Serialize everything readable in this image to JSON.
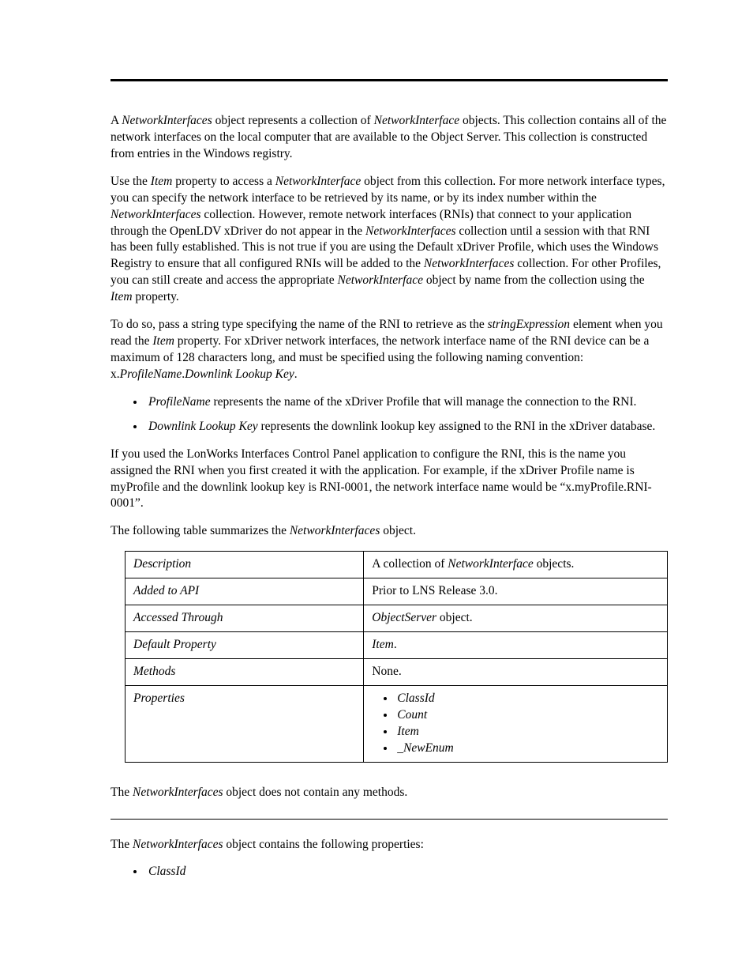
{
  "intro": {
    "p1_a": "A ",
    "p1_em1": "NetworkInterfaces",
    "p1_b": " object represents a collection of ",
    "p1_em2": "NetworkInterface",
    "p1_c": " objects.  This collection contains all of the network interfaces on the local computer that are available to the Object Server.  This collection is constructed from entries in the Windows registry.",
    "p2_a": "Use the ",
    "p2_em1": "Item",
    "p2_b": " property to access a ",
    "p2_em2": "NetworkInterface",
    "p2_c": " object from this collection. For more network interface types, you can specify the network interface to be retrieved by its name, or by its index number within the ",
    "p2_em3": "NetworkInterfaces",
    "p2_d": " collection. However, remote network interfaces (RNIs) that connect to your application through the OpenLDV xDriver do not appear in the ",
    "p2_em4": "NetworkInterfaces",
    "p2_e": " collection until a session with that RNI has been fully established. This is not true if you are using the Default xDriver Profile, which uses the Windows Registry to ensure that all configured RNIs will be added to the ",
    "p2_em5": "NetworkInterfaces",
    "p2_f": " collection. For other Profiles, you can still create and access the appropriate ",
    "p2_em6": "NetworkInterface",
    "p2_g": " object by name from the collection using the ",
    "p2_em7": "Item",
    "p2_h": " property.",
    "p3_a": "To do so, pass a string type specifying the name of the RNI to retrieve as the ",
    "p3_em1": "stringExpression",
    "p3_b": " element when you read the ",
    "p3_em2": "Item",
    "p3_c": " property. For xDriver network interfaces, the network interface name of the RNI device can be a maximum of 128 characters long, and must be specified using the following naming convention: x.",
    "p3_em3": "ProfileName",
    "p3_d": ".",
    "p3_em4": "Downlink Lookup Key",
    "p3_e": "."
  },
  "list1": {
    "li1_em": "ProfileName",
    "li1_txt": " represents the name of the xDriver Profile that will manage the connection to the RNI.",
    "li2_em": "Downlink Lookup Key",
    "li2_txt": " represents the downlink lookup key assigned to the RNI in the xDriver database."
  },
  "after_list": {
    "p4": "If you used the LonWorks Interfaces Control Panel application to configure the RNI, this is the name you assigned the RNI when you first created it with the application. For example, if the xDriver Profile name is myProfile and the downlink lookup key is RNI-0001, the network interface name would be “x.myProfile.RNI-0001”.",
    "p5_a": "The following table summarizes the ",
    "p5_em": "NetworkInterfaces",
    "p5_b": " object."
  },
  "table": {
    "row1_k": "Description",
    "row1_a": "A collection of ",
    "row1_em": "NetworkInterface",
    "row1_b": " objects.",
    "row2_k": "Added to API",
    "row2_v": "Prior to LNS Release 3.0.",
    "row3_k": "Accessed Through",
    "row3_em": "ObjectServer",
    "row3_b": " object.",
    "row4_k": "Default Property",
    "row4_em": "Item",
    "row4_b": ".",
    "row5_k": "Methods",
    "row5_v": "None.",
    "row6_k": "Properties",
    "row6_items": {
      "i1": "ClassId",
      "i2": "Count",
      "i3": "Item",
      "i4": "_NewEnum"
    }
  },
  "methods": {
    "p_a": "The ",
    "p_em": "NetworkInterfaces",
    "p_b": " object does not contain any methods."
  },
  "properties": {
    "p_a": "The ",
    "p_em": "NetworkInterfaces",
    "p_b": " object contains the following properties:",
    "li1": "ClassId"
  }
}
